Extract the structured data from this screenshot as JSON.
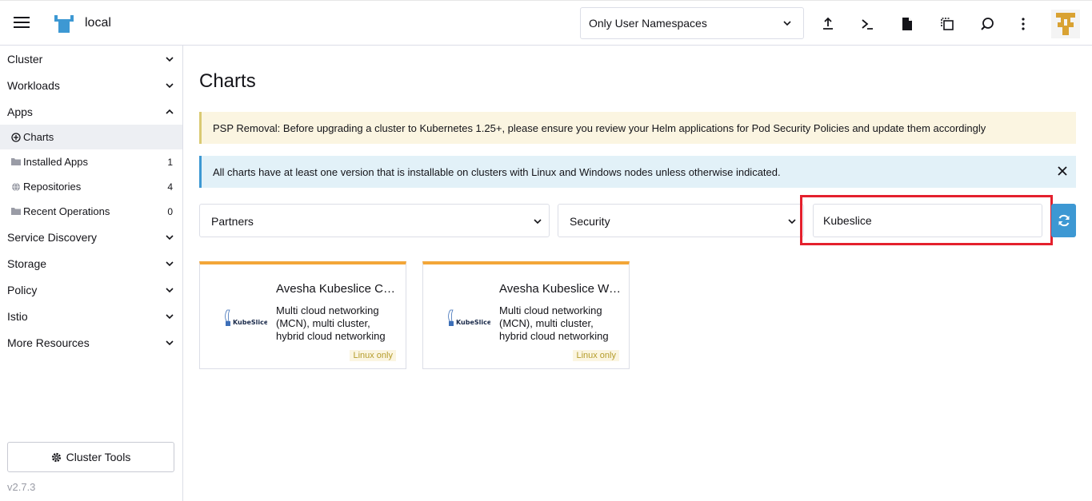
{
  "header": {
    "cluster_name": "local",
    "namespace_filter": "Only User Namespaces",
    "icons": [
      "menu-icon",
      "import-yaml-icon",
      "kubectl-shell-icon",
      "kubeconfig-download-icon",
      "copy-kubeconfig-icon",
      "search-icon",
      "more-options-icon"
    ]
  },
  "sidebar": {
    "groups": [
      {
        "label": "Cluster"
      },
      {
        "label": "Workloads"
      },
      {
        "label": "Apps"
      },
      {
        "label": "Service Discovery"
      },
      {
        "label": "Storage"
      },
      {
        "label": "Policy"
      },
      {
        "label": "Istio"
      },
      {
        "label": "More Resources"
      }
    ],
    "apps_items": [
      {
        "label": "Charts",
        "count": "",
        "icon": "add-circle-icon"
      },
      {
        "label": "Installed Apps",
        "count": "1",
        "icon": "folder-icon"
      },
      {
        "label": "Repositories",
        "count": "4",
        "icon": "globe-icon"
      },
      {
        "label": "Recent Operations",
        "count": "0",
        "icon": "folder-icon"
      }
    ],
    "cluster_tools": "Cluster Tools",
    "version": "v2.7.3"
  },
  "main": {
    "title": "Charts",
    "warning_banner": "PSP Removal: Before upgrading a cluster to Kubernetes 1.25+, please ensure you review your Helm applications for Pod Security Policies and update them accordingly",
    "info_banner": "All charts have at least one version that is installable on clusters with Linux and Windows nodes unless otherwise indicated.",
    "filters": {
      "repo": "Partners",
      "category": "Security",
      "search_value": "Kubeslice"
    },
    "cards": [
      {
        "title": "Avesha Kubeslice Controller",
        "description": "Multi cloud networking (MCN), multi cluster, hybrid cloud networking",
        "badge": "Linux only",
        "logo_text": "KubeSlice"
      },
      {
        "title": "Avesha Kubeslice Worker",
        "description": "Multi cloud networking (MCN), multi cluster, hybrid cloud networking",
        "badge": "Linux only",
        "logo_text": "KubeSlice"
      }
    ]
  },
  "colors": {
    "accent": "#3d98d3",
    "card_top": "#f3a638",
    "highlight": "#e4202d",
    "warning_bg": "#fbf5e1",
    "info_bg": "#e2f1f8"
  }
}
